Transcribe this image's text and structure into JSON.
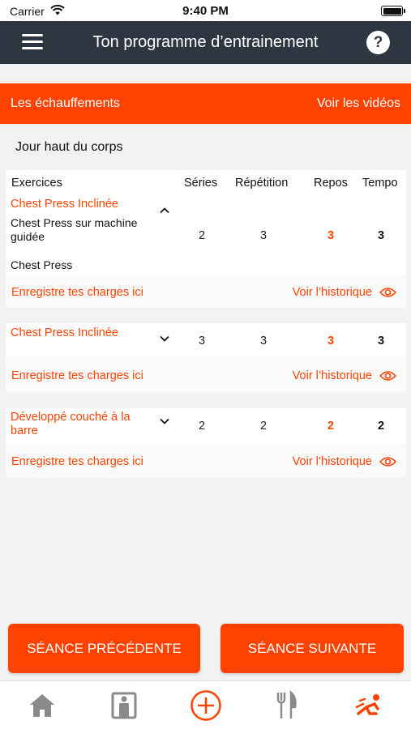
{
  "status": {
    "carrier": "Carrier",
    "time": "9:40 PM"
  },
  "nav": {
    "title": "Ton programme d’entrainement",
    "help": "?"
  },
  "warmup": {
    "label": "Les échauffements",
    "videos": "Voir les vidéos"
  },
  "day_title": "Jour haut du corps",
  "columns": {
    "exercices": "Exercices",
    "series": "Séries",
    "repetition": "Répétition",
    "repos": "Repos",
    "tempo": "Tempo"
  },
  "exercises": [
    {
      "name": "Chest Press Inclinée",
      "expanded": true,
      "variant_1": "Chest Press sur machine guidée",
      "variant_2": "Chest Press",
      "series": "2",
      "repetition": "3",
      "repos": "3",
      "tempo": "3",
      "charges": "Enregistre tes charges ici",
      "history": "Voir l’historique"
    },
    {
      "name": "Chest Press Inclinée",
      "expanded": false,
      "series": "3",
      "repetition": "3",
      "repos": "3",
      "tempo": "3",
      "charges": "Enregistre tes charges ici",
      "history": "Voir l’historique"
    },
    {
      "name": "Développé couché à la barre",
      "expanded": false,
      "series": "2",
      "repetition": "2",
      "repos": "2",
      "tempo": "2",
      "charges": "Enregistre tes charges ici",
      "history": "Voir l’historique"
    }
  ],
  "buttons": {
    "previous": "SÉANCE PRÉCÉDENTE",
    "next": "SÉANCE SUIVANTE"
  },
  "tabs": [
    "home-icon",
    "body-measure-icon",
    "add-circle-icon",
    "fork-knife-icon",
    "workout-icon"
  ],
  "colors": {
    "accent": "#ff4200",
    "navbar": "#2e3641",
    "tab_inactive": "#8a8a8a"
  }
}
